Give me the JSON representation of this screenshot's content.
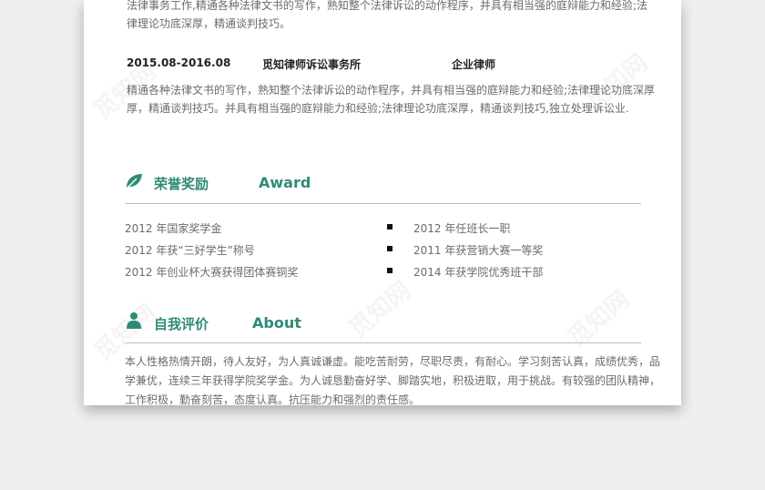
{
  "experience": {
    "prev_desc_line1": "法律事务工作,精通各种法律文书的写作，熟知整个法律诉讼的动作程序，并具有相当强的庭辩能力和经验;法",
    "prev_desc_line2": "律理论功底深厚，精通谈判技巧。",
    "entry": {
      "date": "2015.08-2016.08",
      "company": "觅知律师诉讼事务所",
      "role": "企业律师",
      "desc_line1": "精通各种法律文书的写作，熟知整个法律诉讼的动作程序，并具有相当强的庭辩能力和经验;法律理论功底深厚",
      "desc_line2": "厚，精通谈判技巧。并具有相当强的庭辩能力和经验;法律理论功底深厚，精通谈判技巧,独立处理诉讼业."
    }
  },
  "award": {
    "title_cn": "荣誉奖励",
    "title_en": "Award",
    "icon": "leaf-icon",
    "left": [
      "2012 年国家奖学金",
      "2012 年获“三好学生”称号",
      "2012 年创业杯大赛获得团体赛铜奖"
    ],
    "right": [
      "2012 年任班长一职",
      "2011 年获营销大赛一等奖",
      "2014 年获学院优秀班干部"
    ]
  },
  "about": {
    "title_cn": "自我评价",
    "title_en": "About",
    "icon": "person-icon",
    "line1": "本人性格热情开朗，待人友好，为人真诚谦虚。能吃苦耐劳，尽职尽责，有耐心。学习刻苦认真，成绩优秀，品",
    "line2": "学兼优，连续三年获得学院奖学金。为人诚恳勤奋好学、脚踏实地，积极进取，用于挑战。有较强的团队精神，",
    "line3": "工作积极，勤奋刻苦，态度认真。抗压能力和强烈的责任感。"
  },
  "watermark": "觅知网",
  "colors": {
    "accent": "#2f8b76",
    "text": "#6b6b6b",
    "background": "#efefef"
  }
}
